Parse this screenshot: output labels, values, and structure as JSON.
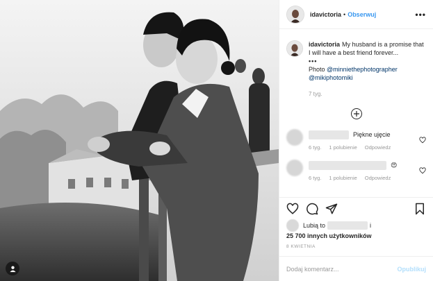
{
  "header": {
    "username": "idavictoria",
    "separator": "•",
    "follow_label": "Obserwuj",
    "more_label": "•••"
  },
  "caption": {
    "username": "idavictoria",
    "text": "My husband is a promise that I will have a best friend forever...",
    "ellipsis": "•••",
    "photo_label": "Photo",
    "mention_1": "@minniethephotographer",
    "mention_2": "@mikiphotomiki",
    "time": "7 tyg."
  },
  "comments": [
    {
      "text": "Piękne ujęcie",
      "time": "6 tyg.",
      "likes": "1 polubienie",
      "reply": "Odpowiedz"
    },
    {
      "text": "😍",
      "time": "6 tyg.",
      "likes": "1 polubienie",
      "reply": "Odpowiedz"
    }
  ],
  "likes": {
    "prefix": "Lubią to",
    "and": "i",
    "others": "25 700 innych użytkowników"
  },
  "date": "8 KWIETNIA",
  "add_comment": {
    "placeholder": "Dodaj komentarz...",
    "publish_label": "Opublikuj"
  },
  "icons": {
    "like": "heart-icon",
    "comment": "comment-icon",
    "share": "share-icon",
    "save": "bookmark-icon",
    "add": "plus-circle-icon",
    "tag": "person-tag-icon"
  },
  "colors": {
    "link_blue": "#3897f0",
    "publish_disabled": "#b2dffc",
    "mention": "#003569",
    "muted": "#999999"
  }
}
